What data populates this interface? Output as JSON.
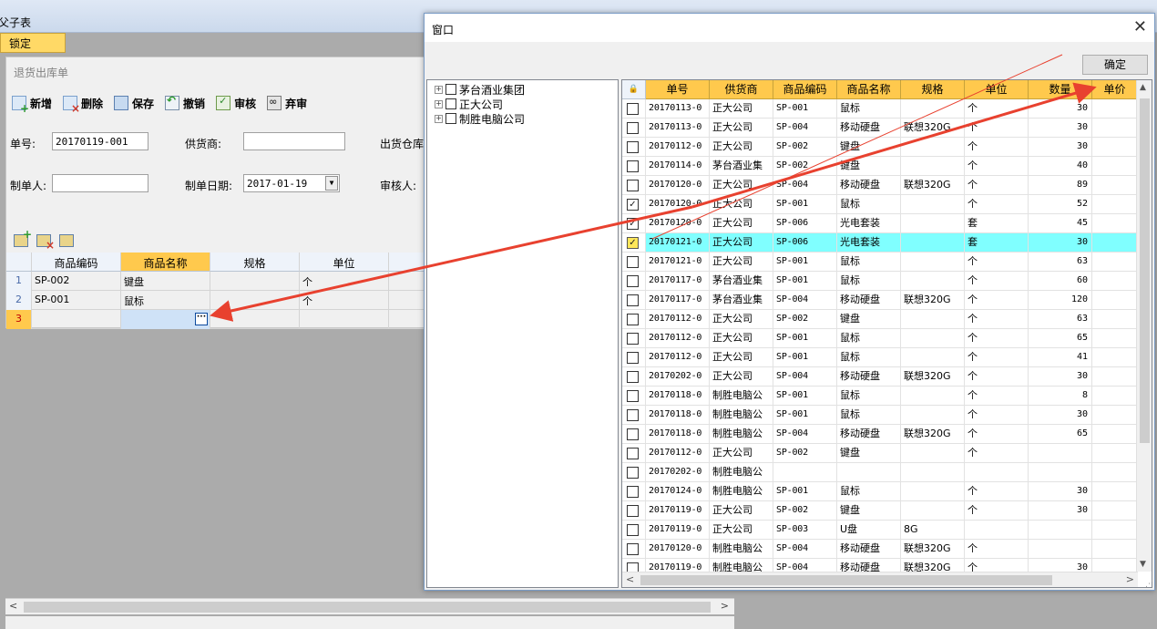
{
  "app": {
    "title": "父子表",
    "lock_tab": "锁定"
  },
  "form": {
    "title": "退货出库单",
    "toolbar": [
      "新增",
      "删除",
      "保存",
      "撤销",
      "审核",
      "弃审"
    ],
    "labels": {
      "order_no": "单号:",
      "supplier": "供货商:",
      "warehouse": "出货仓库",
      "maker": "制单人:",
      "date": "制单日期:",
      "auditor": "审核人:"
    },
    "values": {
      "order_no": "20170119-001",
      "supplier": "",
      "maker": "",
      "date": "2017-01-19"
    },
    "detail_grid": {
      "columns": [
        "商品编码",
        "商品名称",
        "规格",
        "单位"
      ],
      "rows": [
        {
          "idx": "1",
          "code": "SP-002",
          "name": "键盘",
          "spec": "",
          "unit": "个"
        },
        {
          "idx": "2",
          "code": "SP-001",
          "name": "鼠标",
          "spec": "",
          "unit": "个"
        },
        {
          "idx": "3",
          "code": "",
          "name": "",
          "spec": "",
          "unit": ""
        }
      ],
      "ellipsis": "···"
    }
  },
  "window": {
    "title": "窗口",
    "close": "✕",
    "ok_button": "确定",
    "tree": [
      "茅台酒业集团",
      "正大公司",
      "制胜电脑公司"
    ],
    "grid": {
      "columns": [
        "单号",
        "供货商",
        "商品编码",
        "商品名称",
        "规格",
        "单位",
        "数量",
        "单价"
      ],
      "rows": [
        {
          "checked": false,
          "no": "20170113-0",
          "supplier": "正大公司",
          "code": "SP-001",
          "name": "鼠标",
          "spec": "",
          "unit": "个",
          "qty": "30"
        },
        {
          "checked": false,
          "no": "20170113-0",
          "supplier": "正大公司",
          "code": "SP-004",
          "name": "移动硬盘",
          "spec": "联想320G",
          "unit": "个",
          "qty": "30"
        },
        {
          "checked": false,
          "no": "20170112-0",
          "supplier": "正大公司",
          "code": "SP-002",
          "name": "键盘",
          "spec": "",
          "unit": "个",
          "qty": "30"
        },
        {
          "checked": false,
          "no": "20170114-0",
          "supplier": "茅台酒业集",
          "code": "SP-002",
          "name": "键盘",
          "spec": "",
          "unit": "个",
          "qty": "40"
        },
        {
          "checked": false,
          "no": "20170120-0",
          "supplier": "正大公司",
          "code": "SP-004",
          "name": "移动硬盘",
          "spec": "联想320G",
          "unit": "个",
          "qty": "89"
        },
        {
          "checked": true,
          "no": "20170120-0",
          "supplier": "正大公司",
          "code": "SP-001",
          "name": "鼠标",
          "spec": "",
          "unit": "个",
          "qty": "52"
        },
        {
          "checked": true,
          "no": "20170120-0",
          "supplier": "正大公司",
          "code": "SP-006",
          "name": "光电套装",
          "spec": "",
          "unit": "套",
          "qty": "45"
        },
        {
          "checked": true,
          "selected": true,
          "no": "20170121-0",
          "supplier": "正大公司",
          "code": "SP-006",
          "name": "光电套装",
          "spec": "",
          "unit": "套",
          "qty": "30"
        },
        {
          "checked": false,
          "no": "20170121-0",
          "supplier": "正大公司",
          "code": "SP-001",
          "name": "鼠标",
          "spec": "",
          "unit": "个",
          "qty": "63"
        },
        {
          "checked": false,
          "no": "20170117-0",
          "supplier": "茅台酒业集",
          "code": "SP-001",
          "name": "鼠标",
          "spec": "",
          "unit": "个",
          "qty": "60"
        },
        {
          "checked": false,
          "no": "20170117-0",
          "supplier": "茅台酒业集",
          "code": "SP-004",
          "name": "移动硬盘",
          "spec": "联想320G",
          "unit": "个",
          "qty": "120"
        },
        {
          "checked": false,
          "no": "20170112-0",
          "supplier": "正大公司",
          "code": "SP-002",
          "name": "键盘",
          "spec": "",
          "unit": "个",
          "qty": "63"
        },
        {
          "checked": false,
          "no": "20170112-0",
          "supplier": "正大公司",
          "code": "SP-001",
          "name": "鼠标",
          "spec": "",
          "unit": "个",
          "qty": "65"
        },
        {
          "checked": false,
          "no": "20170112-0",
          "supplier": "正大公司",
          "code": "SP-001",
          "name": "鼠标",
          "spec": "",
          "unit": "个",
          "qty": "41"
        },
        {
          "checked": false,
          "no": "20170202-0",
          "supplier": "正大公司",
          "code": "SP-004",
          "name": "移动硬盘",
          "spec": "联想320G",
          "unit": "个",
          "qty": "30"
        },
        {
          "checked": false,
          "no": "20170118-0",
          "supplier": "制胜电脑公",
          "code": "SP-001",
          "name": "鼠标",
          "spec": "",
          "unit": "个",
          "qty": "8"
        },
        {
          "checked": false,
          "no": "20170118-0",
          "supplier": "制胜电脑公",
          "code": "SP-001",
          "name": "鼠标",
          "spec": "",
          "unit": "个",
          "qty": "30"
        },
        {
          "checked": false,
          "no": "20170118-0",
          "supplier": "制胜电脑公",
          "code": "SP-004",
          "name": "移动硬盘",
          "spec": "联想320G",
          "unit": "个",
          "qty": "65"
        },
        {
          "checked": false,
          "no": "20170112-0",
          "supplier": "正大公司",
          "code": "SP-002",
          "name": "键盘",
          "spec": "",
          "unit": "个",
          "qty": ""
        },
        {
          "checked": false,
          "no": "20170202-0",
          "supplier": "制胜电脑公",
          "code": "",
          "name": "",
          "spec": "",
          "unit": "",
          "qty": ""
        },
        {
          "checked": false,
          "no": "20170124-0",
          "supplier": "制胜电脑公",
          "code": "SP-001",
          "name": "鼠标",
          "spec": "",
          "unit": "个",
          "qty": "30"
        },
        {
          "checked": false,
          "no": "20170119-0",
          "supplier": "正大公司",
          "code": "SP-002",
          "name": "键盘",
          "spec": "",
          "unit": "个",
          "qty": "30"
        },
        {
          "checked": false,
          "no": "20170119-0",
          "supplier": "正大公司",
          "code": "SP-003",
          "name": "U盘",
          "spec": "8G",
          "unit": "",
          "qty": ""
        },
        {
          "checked": false,
          "no": "20170120-0",
          "supplier": "制胜电脑公",
          "code": "SP-004",
          "name": "移动硬盘",
          "spec": "联想320G",
          "unit": "个",
          "qty": ""
        },
        {
          "checked": false,
          "no": "20170119-0",
          "supplier": "制胜电脑公",
          "code": "SP-004",
          "name": "移动硬盘",
          "spec": "联想320G",
          "unit": "个",
          "qty": "30"
        }
      ]
    }
  },
  "annotation": {
    "arrow_color": "#e8412f"
  }
}
